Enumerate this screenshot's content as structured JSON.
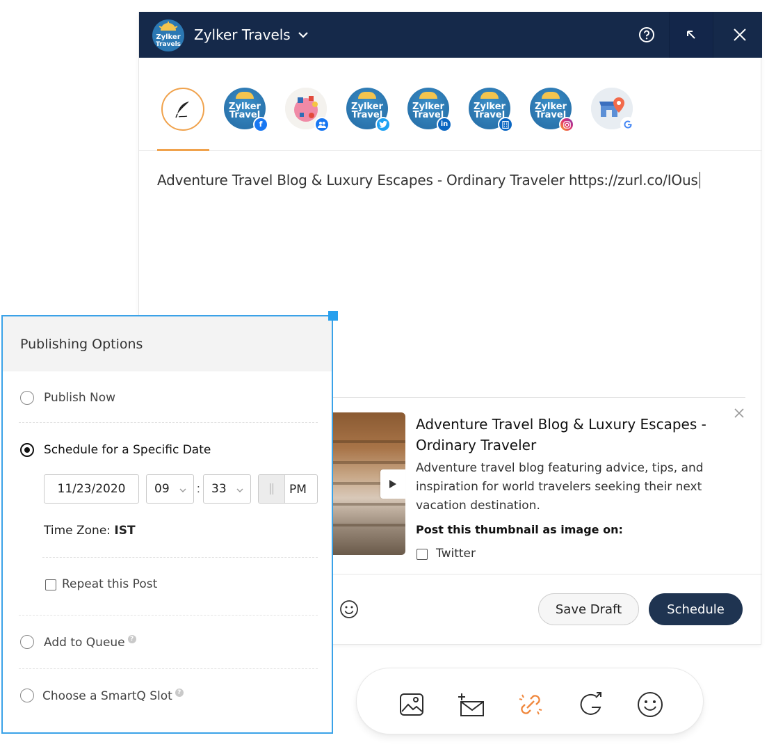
{
  "window": {
    "account_name": "Zylker Travels",
    "brand_logo_text": "Zylker Travels",
    "colors": {
      "header_bg": "#15294a",
      "accent": "#f0a24c",
      "primary_button": "#1f3451",
      "panel_border": "#3aa2e8"
    }
  },
  "profiles": [
    {
      "name": "compose",
      "icon": "quill-pen-icon"
    },
    {
      "name": "facebook",
      "avatar_text": "Zylker Travels",
      "network_badge": "facebook-icon"
    },
    {
      "name": "facebook-group",
      "network_badge": "group-icon"
    },
    {
      "name": "twitter",
      "avatar_text": "Zylker Travels",
      "network_badge": "twitter-icon"
    },
    {
      "name": "linkedin",
      "avatar_text": "Zylker Travels",
      "network_badge": "linkedin-icon"
    },
    {
      "name": "linkedin-page",
      "avatar_text": "Zylker Travels",
      "network_badge": "building-icon"
    },
    {
      "name": "instagram",
      "avatar_text": "Zylker Travels",
      "network_badge": "instagram-icon"
    },
    {
      "name": "google-my-business",
      "network_badge": "google-icon"
    }
  ],
  "post": {
    "text": "Adventure Travel Blog & Luxury Escapes - Ordinary Traveler https://zurl.co/IOus"
  },
  "link_preview": {
    "title": "Adventure Travel Blog & Luxury Escapes - Ordinary Traveler",
    "description": "Adventure travel blog featuring advice, tips, and inspiration for world travelers seeking their next vacation destination.",
    "thumbnail_post_label": "Post this thumbnail as image on:",
    "thumbnail_network": "Twitter",
    "thumbnail_network_checked": false
  },
  "actions": {
    "save_draft": "Save Draft",
    "schedule": "Schedule"
  },
  "toolbar": {
    "tools": [
      "image-icon",
      "newsletter-icon",
      "link-icon",
      "share-icon",
      "emoji-icon"
    ]
  },
  "publishing_options": {
    "title": "Publishing Options",
    "publish_now": "Publish Now",
    "schedule_specific": "Schedule for a Specific Date",
    "selected": "schedule_specific",
    "date": "11/23/2020",
    "hour": "09",
    "minute": "33",
    "colon": ":",
    "meridiem": "PM",
    "timezone_label": "Time Zone:",
    "timezone_value": "IST",
    "repeat_post": "Repeat this Post",
    "repeat_checked": false,
    "add_to_queue": "Add to Queue",
    "smartq": "Choose a SmartQ Slot",
    "help_glyph": "?"
  }
}
